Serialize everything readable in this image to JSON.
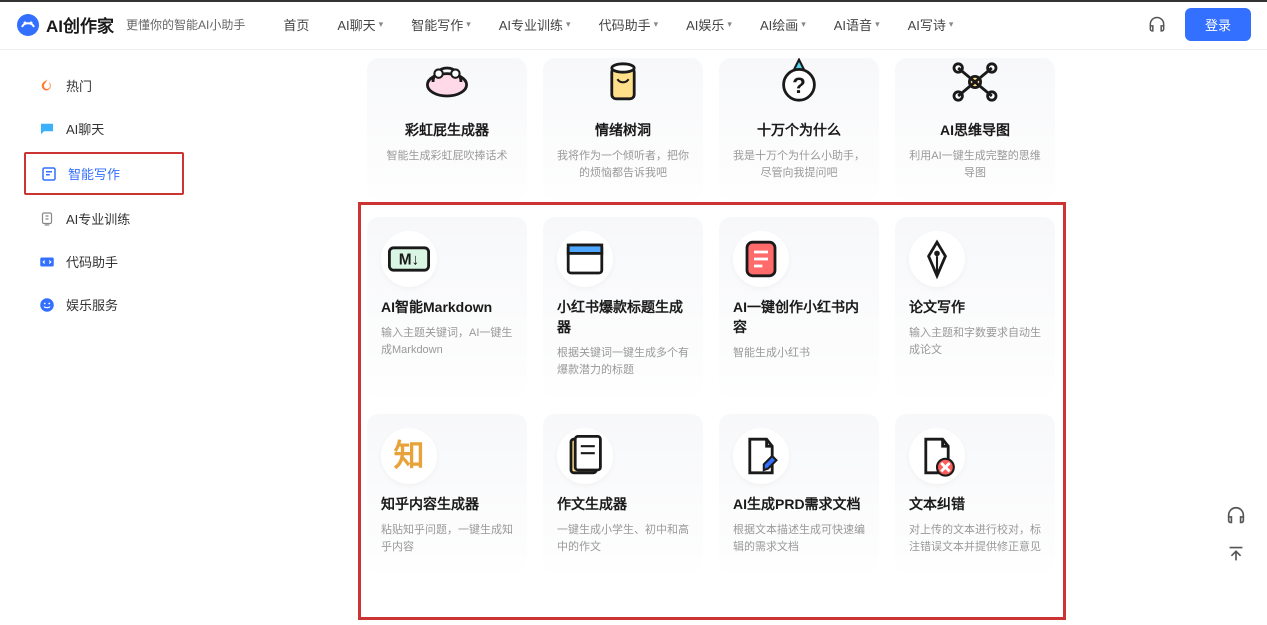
{
  "header": {
    "brand": "AI创作家",
    "subtitle": "更懂你的智能AI小助手",
    "nav": [
      "首页",
      "AI聊天",
      "智能写作",
      "AI专业训练",
      "代码助手",
      "AI娱乐",
      "AI绘画",
      "AI语音",
      "AI写诗"
    ],
    "nav_has_chevron": [
      false,
      true,
      true,
      true,
      true,
      true,
      true,
      true,
      true
    ],
    "login": "登录"
  },
  "sidebar": {
    "items": [
      {
        "label": "热门",
        "icon": "flame"
      },
      {
        "label": "AI聊天",
        "icon": "chat"
      },
      {
        "label": "智能写作",
        "icon": "write",
        "active": true
      },
      {
        "label": "AI专业训练",
        "icon": "train"
      },
      {
        "label": "代码助手",
        "icon": "code"
      },
      {
        "label": "娱乐服务",
        "icon": "smile"
      }
    ]
  },
  "cards_top": [
    {
      "title": "彩虹屁生成器",
      "desc": "智能生成彩虹屁吹捧话术"
    },
    {
      "title": "情绪树洞",
      "desc": "我将作为一个倾听者，把你的烦恼都告诉我吧"
    },
    {
      "title": "十万个为什么",
      "desc": "我是十万个为什么小助手，尽管向我提问吧"
    },
    {
      "title": "AI思维导图",
      "desc": "利用AI一键生成完整的思维导图"
    }
  ],
  "cards_mid": [
    {
      "title": "AI智能Markdown",
      "desc": "输入主题关键词，AI一键生成Markdown"
    },
    {
      "title": "小红书爆款标题生成器",
      "desc": "根据关键词一键生成多个有爆款潜力的标题"
    },
    {
      "title": "AI一键创作小红书内容",
      "desc": "智能生成小红书"
    },
    {
      "title": "论文写作",
      "desc": "输入主题和字数要求自动生成论文"
    }
  ],
  "cards_bot": [
    {
      "title": "知乎内容生成器",
      "desc": "粘贴知乎问题，一键生成知乎内容"
    },
    {
      "title": "作文生成器",
      "desc": "一键生成小学生、初中和高中的作文"
    },
    {
      "title": "AI生成PRD需求文档",
      "desc": "根据文本描述生成可快速编辑的需求文档"
    },
    {
      "title": "文本纠错",
      "desc": "对上传的文本进行校对，标注错误文本并提供修正意见"
    }
  ]
}
